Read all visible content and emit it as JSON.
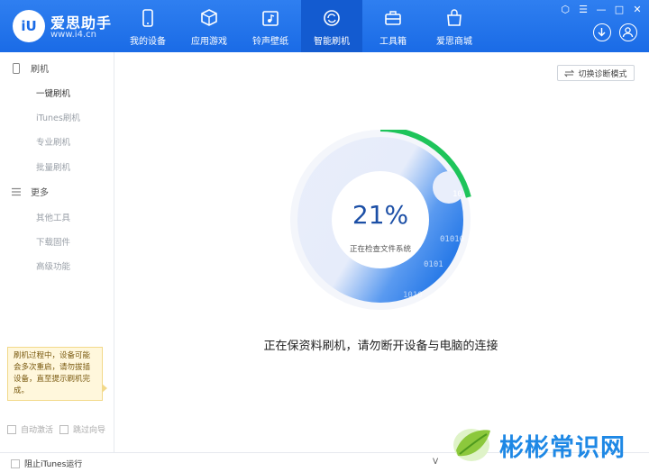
{
  "brand": {
    "name": "爱思助手",
    "url": "www.i4.cn",
    "logo_text": "iU"
  },
  "nav": {
    "items": [
      {
        "label": "我的设备",
        "icon": "phone-icon"
      },
      {
        "label": "应用游戏",
        "icon": "box-icon"
      },
      {
        "label": "铃声壁纸",
        "icon": "music-folder-icon"
      },
      {
        "label": "智能刷机",
        "icon": "refresh-icon"
      },
      {
        "label": "工具箱",
        "icon": "toolbox-icon"
      },
      {
        "label": "爱思商城",
        "icon": "shopping-bag-icon"
      }
    ],
    "active_index": 3
  },
  "window_controls": [
    "⬡",
    "☰",
    "—",
    "□",
    "✕"
  ],
  "sidebar": {
    "sections": [
      {
        "label": "刷机",
        "icon": "phone-outline-icon"
      },
      {
        "label": "更多",
        "icon": "menu-icon"
      }
    ],
    "flash_items": [
      "一键刷机",
      "iTunes刷机",
      "专业刷机",
      "批量刷机"
    ],
    "more_items": [
      "其他工具",
      "下载固件",
      "高级功能"
    ],
    "active_item": "一键刷机",
    "warning": "刷机过程中，设备可能会多次重启，请勿拔插设备，直至提示刷机完成。",
    "auto_activate_label": "自动激活",
    "skip_guide_label": "跳过向导"
  },
  "bottombar": {
    "block_itunes_label": "阻止iTunes运行",
    "version_prefix": "V"
  },
  "main": {
    "mode_button_label": "切换诊断模式",
    "progress_text": "21%",
    "progress_value": 0.21,
    "progress_status": "正在检查文件系统",
    "binary_texts": [
      "10",
      "01010",
      "0101",
      "1010"
    ],
    "message": "正在保资料刷机，请勿断开设备与电脑的连接"
  },
  "watermark": {
    "text": "彬彬常识网"
  },
  "colors": {
    "primary": "#1a6be6",
    "nav_active": "#135bd0",
    "progress_green": "#1ec45a",
    "ring_blue": "#2f80ed"
  }
}
